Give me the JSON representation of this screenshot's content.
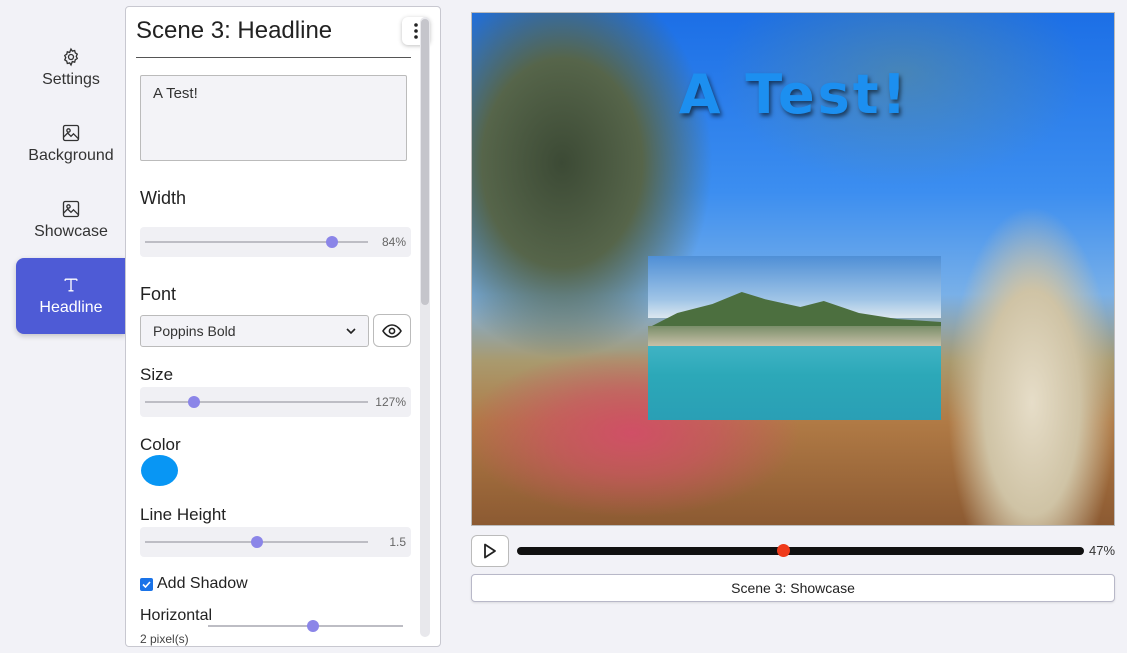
{
  "nav": {
    "items": [
      {
        "label": "Settings",
        "icon": "gear-icon"
      },
      {
        "label": "Background",
        "icon": "image-icon"
      },
      {
        "label": "Showcase",
        "icon": "image-icon"
      },
      {
        "label": "Headline",
        "icon": "text-icon",
        "active": true
      }
    ]
  },
  "panel": {
    "title": "Scene 3: Headline",
    "text_value": "A Test!",
    "width": {
      "label": "Width",
      "value": 84,
      "display": "84%"
    },
    "font": {
      "label": "Font",
      "selected": "Poppins Bold"
    },
    "size": {
      "label": "Size",
      "value": 127,
      "display": "127%"
    },
    "color": {
      "label": "Color",
      "value": "#0896f4"
    },
    "line_height": {
      "label": "Line Height",
      "value": 1.5,
      "display": "1.5"
    },
    "shadow": {
      "label": "Add Shadow",
      "checked": true
    },
    "horizontal": {
      "label": "Horizontal",
      "sub": "2 pixel(s)"
    }
  },
  "preview": {
    "headline": "A Test!",
    "headline_color": "#1c8ff0"
  },
  "playback": {
    "progress": 47,
    "display": "47%",
    "scene_button": "Scene 3: Showcase"
  }
}
